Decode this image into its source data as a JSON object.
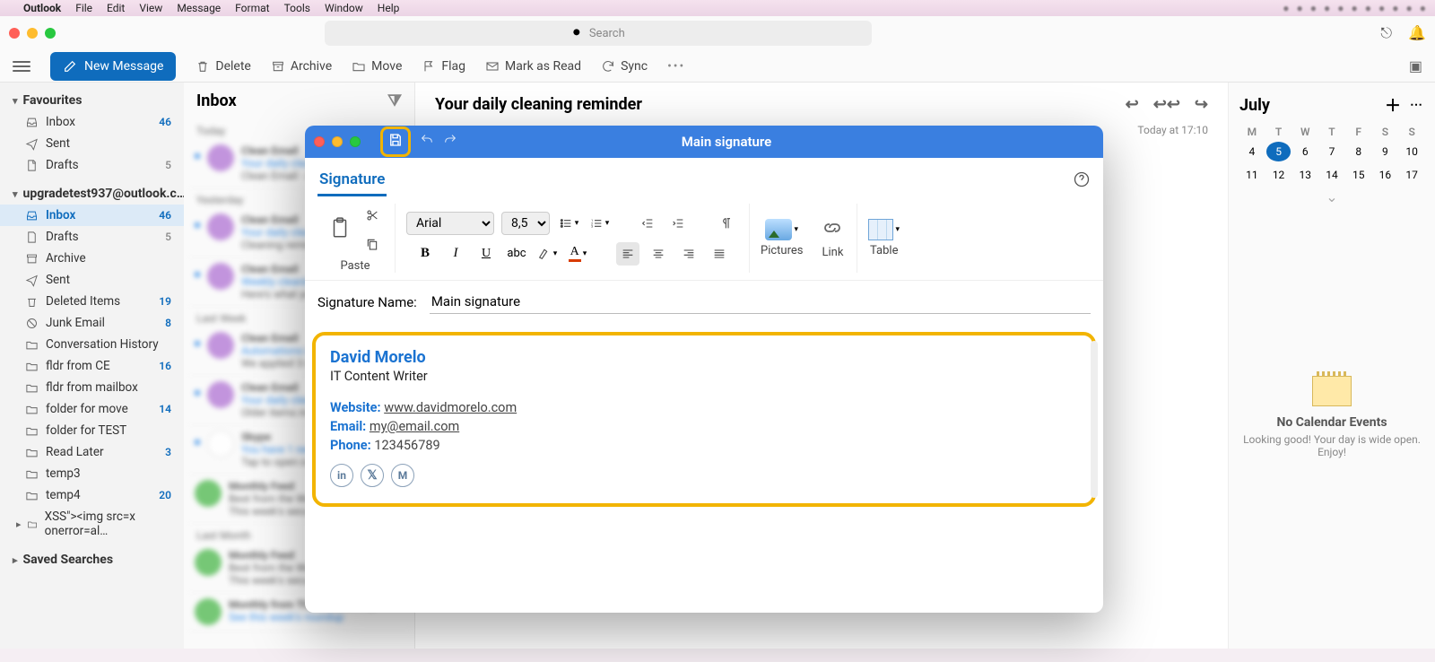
{
  "menubar": {
    "app": "Outlook",
    "items": [
      "File",
      "Edit",
      "View",
      "Message",
      "Format",
      "Tools",
      "Window",
      "Help"
    ]
  },
  "search_placeholder": "Search",
  "new_message": "New Message",
  "toolbar": {
    "delete": "Delete",
    "archive": "Archive",
    "move": "Move",
    "flag": "Flag",
    "mark_read": "Mark as Read",
    "sync": "Sync"
  },
  "sidebar": {
    "favourites": "Favourites",
    "fav_items": [
      {
        "label": "Inbox",
        "badge": "46"
      },
      {
        "label": "Sent",
        "badge": ""
      },
      {
        "label": "Drafts",
        "badge": "5"
      }
    ],
    "account": "upgradetest937@outlook.c…",
    "acct_items": [
      {
        "label": "Inbox",
        "badge": "46",
        "selected": true
      },
      {
        "label": "Drafts",
        "badge": "5"
      },
      {
        "label": "Archive",
        "badge": ""
      },
      {
        "label": "Sent",
        "badge": ""
      },
      {
        "label": "Deleted Items",
        "badge": "19"
      },
      {
        "label": "Junk Email",
        "badge": "8"
      },
      {
        "label": "Conversation History",
        "badge": ""
      },
      {
        "label": "fldr from CE",
        "badge": "16"
      },
      {
        "label": "fldr from mailbox",
        "badge": ""
      },
      {
        "label": "folder for move",
        "badge": "14"
      },
      {
        "label": "folder for TEST",
        "badge": ""
      },
      {
        "label": "Read Later",
        "badge": "3"
      },
      {
        "label": "temp3",
        "badge": ""
      },
      {
        "label": "temp4",
        "badge": "20"
      },
      {
        "label": "XSS\"><img src=x onerror=al…",
        "badge": ""
      }
    ],
    "saved_searches": "Saved Searches"
  },
  "msglist_title": "Inbox",
  "reading": {
    "subject": "Your daily cleaning reminder",
    "timestamp": "Today at 17:10"
  },
  "calendar": {
    "month": "July",
    "dow": [
      "M",
      "T",
      "W",
      "T",
      "F",
      "S",
      "S"
    ],
    "rows": [
      [
        "4",
        "5",
        "6",
        "7",
        "8",
        "9",
        "10"
      ],
      [
        "11",
        "12",
        "13",
        "14",
        "15",
        "16",
        "17"
      ]
    ],
    "today": "5",
    "empty_title": "No Calendar Events",
    "empty_sub": "Looking good! Your day is wide open. Enjoy!"
  },
  "modal": {
    "title": "Main signature",
    "tab": "Signature",
    "ribbon": {
      "paste": "Paste",
      "font": "Arial",
      "size": "8,5",
      "pictures": "Pictures",
      "link": "Link",
      "table": "Table"
    },
    "signame_label": "Signature Name:",
    "signame_value": "Main signature",
    "signature": {
      "name": "David Morelo",
      "title": "IT Content Writer",
      "website_k": "Website:",
      "website_v": "www.davidmorelo.com",
      "email_k": "Email:",
      "email_v": "my@email.com",
      "phone_k": "Phone:",
      "phone_v": "123456789"
    }
  }
}
